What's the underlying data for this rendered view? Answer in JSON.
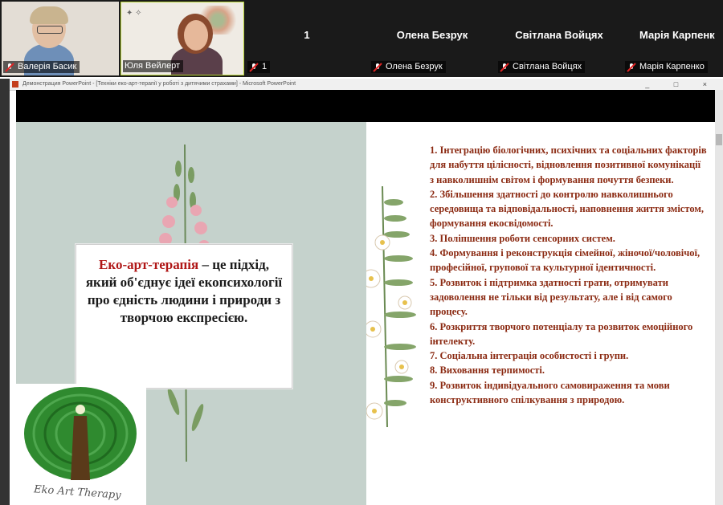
{
  "participants": [
    {
      "name": "Валерія Басик",
      "display": "",
      "has_video": true
    },
    {
      "name": "Юля Вейлерт",
      "display": "",
      "has_video": true
    },
    {
      "name": "1",
      "display": "1",
      "has_video": false
    },
    {
      "name": "Олена Безрук",
      "display": "Олена Безрук",
      "has_video": false
    },
    {
      "name": "Світлана Войцях",
      "display": "Світлана Войцях",
      "has_video": false
    },
    {
      "name": "Марія Карпенко",
      "display": "Марія Карпенк",
      "has_video": false
    }
  ],
  "window": {
    "title": "Демонстрация PowerPoint - [Техніки еко-арт-терапії у роботі з дитячими страхами] - Microsoft PowerPoint",
    "controls": [
      "_",
      "□",
      "×"
    ]
  },
  "slide": {
    "definition": {
      "term": "Еко-арт-терапія",
      "rest": " – це підхід, який об'єднує ідеї екопсихології про єдність людини і природи з творчою експресією."
    },
    "logo_caption": "Eko Art Therapy",
    "items": [
      "1. Інтеграцію біологічних, психічних та соціальних факторів для набуття цілісності, відновлення позитивної комунікації з навколишнім світом і формування почуття безпеки.",
      "2. Збільшення здатності до контролю навколишнього середовища та відповідальності, наповнення життя змістом, формування екосвідомості.",
      "3. Поліпшення роботи сенсорних систем.",
      "4. Формування і реконструкція сімейної, жіночої/чоловічої, професійної, групової та культурної ідентичності.",
      "5. Розвиток і підтримка здатності грати, отримувати задоволення не тільки від результату, але і від самого процесу.",
      "6. Розкриття творчого потенціалу та розвиток емоційного інтелекту.",
      "7. Соціальна інтеграція особистості і групи.",
      "8. Виховання терпимості.",
      "9. Розвиток індивідуального самовираження та мови конструктивного спілкування з природою."
    ]
  }
}
